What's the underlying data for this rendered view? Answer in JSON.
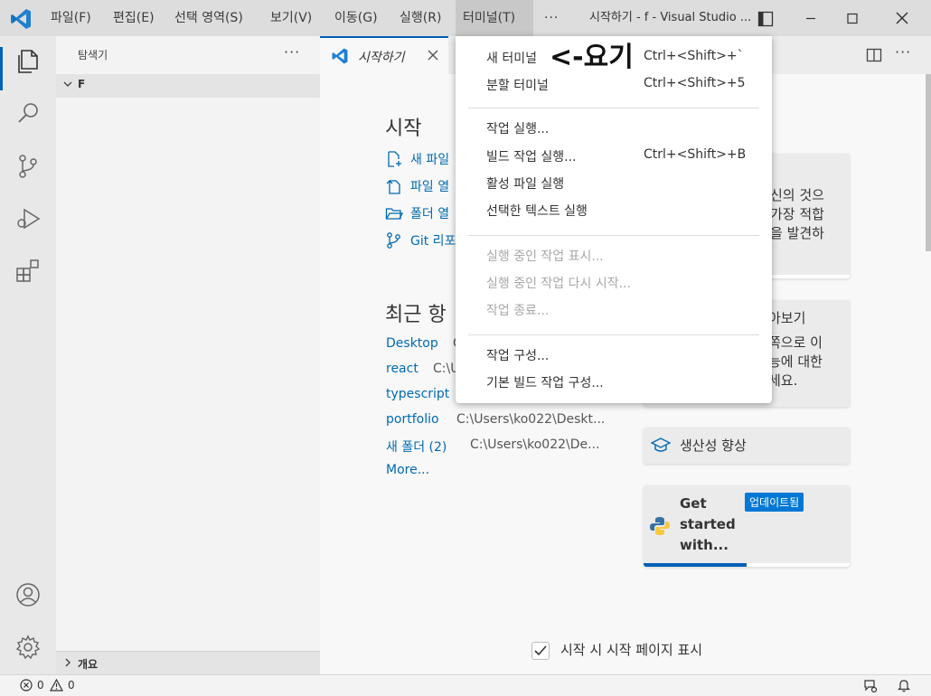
{
  "titlebar": {
    "menus": [
      "파일(F)",
      "편집(E)",
      "선택 영역(S)",
      "보기(V)",
      "이동(G)",
      "실행(R)",
      "터미널(T)"
    ],
    "overflow": "···",
    "window_title": "시작하기 - f - Visual Studio ..."
  },
  "sidebar": {
    "title": "탐색기",
    "more": "···",
    "folder": "F",
    "outline": "개요"
  },
  "editor": {
    "tab_label": "시작하기",
    "more": "···"
  },
  "welcome": {
    "start_title": "시작",
    "start_items": [
      "새 파일",
      "파일 열",
      "폴더 열",
      "Git 리포"
    ],
    "recent_title": "최근 항",
    "recent": [
      {
        "name": "Desktop",
        "path": "C"
      },
      {
        "name": "react",
        "path": "C:\\U"
      },
      {
        "name": "typescript",
        "path": ""
      },
      {
        "name": "portfolio",
        "path": "C:\\Users\\ko022\\Deskt..."
      },
      {
        "name": "새 폴더 (2)",
        "path": "C:\\Users\\ko022\\De..."
      }
    ],
    "more_link": "More...",
    "card1_lines": [
      "신의 것으",
      "가장 적합",
      "을 발견하"
    ],
    "card2_lines": [
      "아보기",
      "쪽으로 이",
      "능에 대한",
      "세요."
    ],
    "card3_title": "생산성 향상",
    "card4_title_lines": [
      "Get",
      "started",
      "with..."
    ],
    "card4_badge": "업데이트됨",
    "card4_progress": 0.5,
    "startup_label": "시작 시 시작 페이지 표시"
  },
  "statusbar": {
    "errors": "0",
    "warnings": "0"
  },
  "terminal_menu": {
    "items": [
      {
        "label": "새 터미널",
        "shortcut": "Ctrl+<Shift>+`",
        "disabled": false
      },
      {
        "label": "분할 터미널",
        "shortcut": "Ctrl+<Shift>+5",
        "disabled": false
      },
      {
        "label": "작업 실행...",
        "shortcut": "",
        "disabled": false
      },
      {
        "label": "빌드 작업 실행...",
        "shortcut": "Ctrl+<Shift>+B",
        "disabled": false
      },
      {
        "label": "활성 파일 실행",
        "shortcut": "",
        "disabled": false
      },
      {
        "label": "선택한 텍스트 실행",
        "shortcut": "",
        "disabled": false
      },
      {
        "label": "실행 중인 작업 표시...",
        "shortcut": "",
        "disabled": true
      },
      {
        "label": "실행 중인 작업 다시 시작...",
        "shortcut": "",
        "disabled": true
      },
      {
        "label": "작업 종료...",
        "shortcut": "",
        "disabled": true
      },
      {
        "label": "작업 구성...",
        "shortcut": "",
        "disabled": false
      },
      {
        "label": "기본 빌드 작업 구성...",
        "shortcut": "",
        "disabled": false
      }
    ]
  },
  "annotation": "<-요기",
  "colors": {
    "accent": "#005fb8",
    "link": "#006ab1",
    "badge": "#0078d4"
  }
}
